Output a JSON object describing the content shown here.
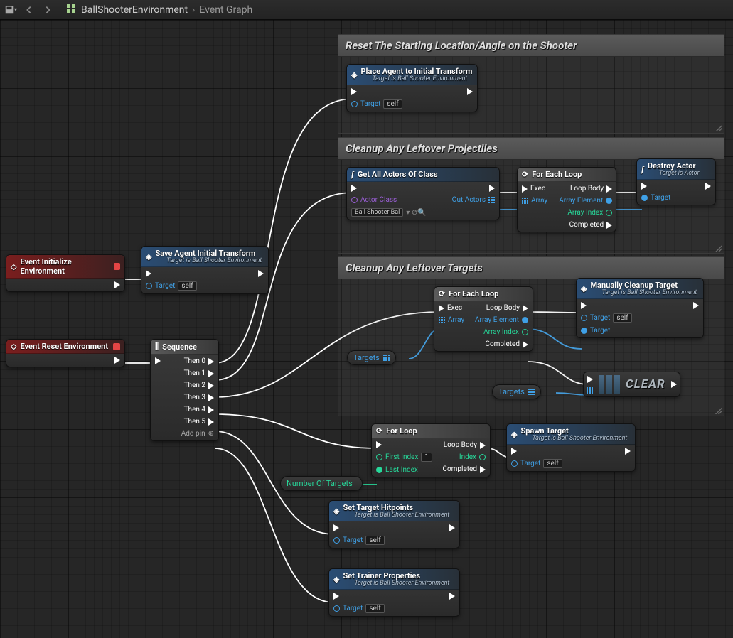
{
  "toolbar": {
    "breadcrumb1": "BallShooterEnvironment",
    "breadcrumb2": "Event Graph"
  },
  "comments": {
    "reset_shooter": "Reset The Starting Location/Angle on the Shooter",
    "cleanup_proj": "Cleanup Any Leftover Projectiles",
    "cleanup_targ": "Cleanup Any Leftover Targets"
  },
  "nodes": {
    "event_init": {
      "title": "Event Initialize Environment"
    },
    "event_reset": {
      "title": "Event Reset Environment"
    },
    "save_agent": {
      "title": "Save Agent Initial Transform",
      "sub": "Target is Ball Shooter Environment",
      "target": "Target",
      "self": "self"
    },
    "sequence": {
      "title": "Sequence",
      "pins": [
        "Then 0",
        "Then 1",
        "Then 2",
        "Then 3",
        "Then 4",
        "Then 5"
      ],
      "addpin": "Add pin"
    },
    "place_agent": {
      "title": "Place Agent to Initial Transform",
      "sub": "Target is Ball Shooter Environment",
      "target": "Target",
      "self": "self"
    },
    "get_actors": {
      "title": "Get All Actors Of Class",
      "actor_class": "Actor Class",
      "actor_val": "Ball Shooter Bal",
      "out_actors": "Out Actors"
    },
    "foreach1": {
      "title": "For Each Loop",
      "exec": "Exec",
      "array": "Array",
      "loopbody": "Loop Body",
      "arrelem": "Array Element",
      "arridx": "Array Index",
      "completed": "Completed"
    },
    "destroy": {
      "title": "Destroy Actor",
      "sub": "Target is Actor",
      "target": "Target"
    },
    "foreach2": {
      "title": "For Each Loop",
      "exec": "Exec",
      "array": "Array",
      "loopbody": "Loop Body",
      "arrelem": "Array Element",
      "arridx": "Array Index",
      "completed": "Completed"
    },
    "targets_var1": "Targets",
    "targets_var2": "Targets",
    "manually_cleanup": {
      "title": "Manually Cleanup Target",
      "sub": "Target is Ball Shooter Environment",
      "target": "Target",
      "self": "self",
      "target2": "Target"
    },
    "clear": "CLEAR",
    "forloop": {
      "title": "For Loop",
      "first": "First Index",
      "firstval": "1",
      "last": "Last Index",
      "loopbody": "Loop Body",
      "index": "Index",
      "completed": "Completed"
    },
    "num_targets": "Number Of Targets",
    "spawn_target": {
      "title": "Spawn Target",
      "sub": "Target is Ball Shooter Environment",
      "target": "Target",
      "self": "self"
    },
    "set_hitpoints": {
      "title": "Set Target Hitpoints",
      "sub": "Target is Ball Shooter Environment",
      "target": "Target",
      "self": "self"
    },
    "set_trainer": {
      "title": "Set Trainer Properties",
      "sub": "Target is Ball Shooter Environment",
      "target": "Target",
      "self": "self"
    }
  }
}
